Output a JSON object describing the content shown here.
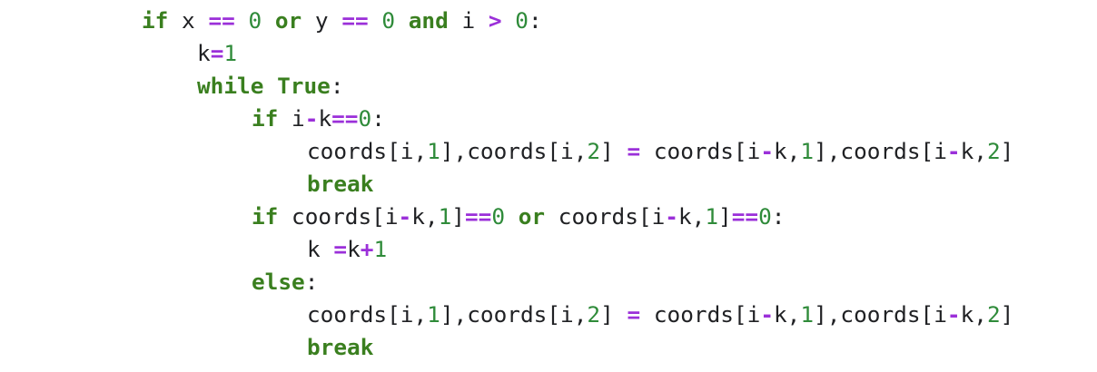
{
  "code": {
    "lines": [
      [
        {
          "t": "if",
          "c": "kw"
        },
        {
          "t": " x ",
          "c": "tx"
        },
        {
          "t": "==",
          "c": "op"
        },
        {
          "t": " ",
          "c": "tx"
        },
        {
          "t": "0",
          "c": "num"
        },
        {
          "t": " ",
          "c": "tx"
        },
        {
          "t": "or",
          "c": "kw"
        },
        {
          "t": " y ",
          "c": "tx"
        },
        {
          "t": "==",
          "c": "op"
        },
        {
          "t": " ",
          "c": "tx"
        },
        {
          "t": "0",
          "c": "num"
        },
        {
          "t": " ",
          "c": "tx"
        },
        {
          "t": "and",
          "c": "kw"
        },
        {
          "t": " i ",
          "c": "tx"
        },
        {
          "t": ">",
          "c": "op"
        },
        {
          "t": " ",
          "c": "tx"
        },
        {
          "t": "0",
          "c": "num"
        },
        {
          "t": ":",
          "c": "tx"
        }
      ],
      [
        {
          "t": "k",
          "c": "tx"
        },
        {
          "t": "=",
          "c": "op"
        },
        {
          "t": "1",
          "c": "num"
        }
      ],
      [
        {
          "t": "while",
          "c": "kw"
        },
        {
          "t": " ",
          "c": "tx"
        },
        {
          "t": "True",
          "c": "kw"
        },
        {
          "t": ":",
          "c": "tx"
        }
      ],
      [
        {
          "t": "if",
          "c": "kw"
        },
        {
          "t": " i",
          "c": "tx"
        },
        {
          "t": "-",
          "c": "op"
        },
        {
          "t": "k",
          "c": "tx"
        },
        {
          "t": "==",
          "c": "op"
        },
        {
          "t": "0",
          "c": "num"
        },
        {
          "t": ":",
          "c": "tx"
        }
      ],
      [
        {
          "t": "coords[i,",
          "c": "tx"
        },
        {
          "t": "1",
          "c": "num"
        },
        {
          "t": "],coords[i,",
          "c": "tx"
        },
        {
          "t": "2",
          "c": "num"
        },
        {
          "t": "] ",
          "c": "tx"
        },
        {
          "t": "=",
          "c": "op"
        },
        {
          "t": " coords[i",
          "c": "tx"
        },
        {
          "t": "-",
          "c": "op"
        },
        {
          "t": "k,",
          "c": "tx"
        },
        {
          "t": "1",
          "c": "num"
        },
        {
          "t": "],coords[i",
          "c": "tx"
        },
        {
          "t": "-",
          "c": "op"
        },
        {
          "t": "k,",
          "c": "tx"
        },
        {
          "t": "2",
          "c": "num"
        },
        {
          "t": "]",
          "c": "tx"
        }
      ],
      [
        {
          "t": "break",
          "c": "kw"
        }
      ],
      [
        {
          "t": "if",
          "c": "kw"
        },
        {
          "t": " coords[i",
          "c": "tx"
        },
        {
          "t": "-",
          "c": "op"
        },
        {
          "t": "k,",
          "c": "tx"
        },
        {
          "t": "1",
          "c": "num"
        },
        {
          "t": "]",
          "c": "tx"
        },
        {
          "t": "==",
          "c": "op"
        },
        {
          "t": "0",
          "c": "num"
        },
        {
          "t": " ",
          "c": "tx"
        },
        {
          "t": "or",
          "c": "kw"
        },
        {
          "t": " coords[i",
          "c": "tx"
        },
        {
          "t": "-",
          "c": "op"
        },
        {
          "t": "k,",
          "c": "tx"
        },
        {
          "t": "1",
          "c": "num"
        },
        {
          "t": "]",
          "c": "tx"
        },
        {
          "t": "==",
          "c": "op"
        },
        {
          "t": "0",
          "c": "num"
        },
        {
          "t": ":",
          "c": "tx"
        }
      ],
      [
        {
          "t": "k ",
          "c": "tx"
        },
        {
          "t": "=",
          "c": "op"
        },
        {
          "t": "k",
          "c": "tx"
        },
        {
          "t": "+",
          "c": "op"
        },
        {
          "t": "1",
          "c": "num"
        }
      ],
      [
        {
          "t": "else",
          "c": "kw"
        },
        {
          "t": ":",
          "c": "tx"
        }
      ],
      [
        {
          "t": "coords[i,",
          "c": "tx"
        },
        {
          "t": "1",
          "c": "num"
        },
        {
          "t": "],coords[i,",
          "c": "tx"
        },
        {
          "t": "2",
          "c": "num"
        },
        {
          "t": "] ",
          "c": "tx"
        },
        {
          "t": "=",
          "c": "op"
        },
        {
          "t": " coords[i",
          "c": "tx"
        },
        {
          "t": "-",
          "c": "op"
        },
        {
          "t": "k,",
          "c": "tx"
        },
        {
          "t": "1",
          "c": "num"
        },
        {
          "t": "],coords[i",
          "c": "tx"
        },
        {
          "t": "-",
          "c": "op"
        },
        {
          "t": "k,",
          "c": "tx"
        },
        {
          "t": "2",
          "c": "num"
        },
        {
          "t": "]",
          "c": "tx"
        }
      ],
      [
        {
          "t": "break",
          "c": "kw"
        }
      ]
    ]
  },
  "colors": {
    "keyword": "#3a7f1f",
    "operator": "#9b30d9",
    "number": "#2f8b3a",
    "text": "#202124",
    "background": "#ffffff"
  }
}
